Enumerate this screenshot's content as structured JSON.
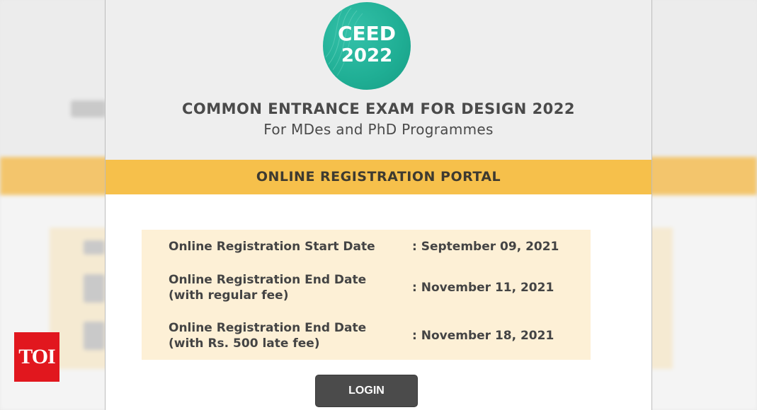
{
  "logo": {
    "line1": "CEED",
    "line2": "2022",
    "color": "#1fae94"
  },
  "header": {
    "title": "COMMON ENTRANCE EXAM FOR DESIGN 2022",
    "subtitle": "For MDes and PhD Programmes"
  },
  "banner": {
    "label": "ONLINE REGISTRATION PORTAL",
    "color": "#f6c04b"
  },
  "dates": [
    {
      "label_line1": "Online Registration Start Date",
      "label_line2": "",
      "value": ": September 09, 2021"
    },
    {
      "label_line1": "Online Registration End Date",
      "label_line2": "(with regular fee)",
      "value": ": November 11, 2021"
    },
    {
      "label_line1": "Online Registration End Date",
      "label_line2": "(with Rs. 500 late fee)",
      "value": ": November 18, 2021"
    }
  ],
  "login": {
    "label": "LOGIN"
  },
  "watermark": {
    "label": "TOI",
    "color": "#e1171e"
  }
}
